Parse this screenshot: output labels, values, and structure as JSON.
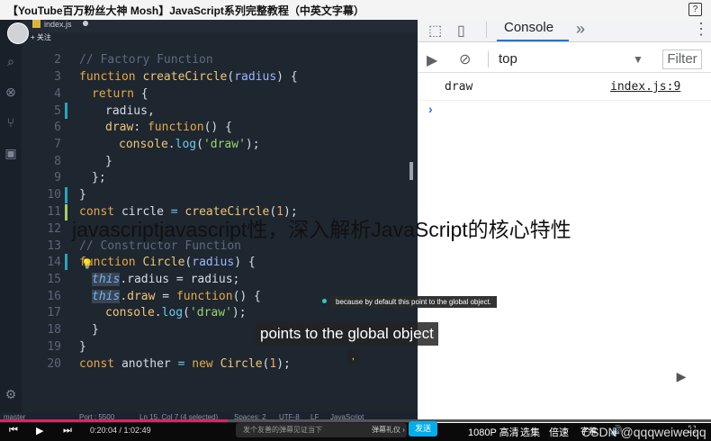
{
  "window": {
    "title": "【YouTube百万粉丝大神 Mosh】JavaScript系列完整教程（中英文字幕）",
    "help_icon": "?"
  },
  "editor": {
    "tab_label": "index.js",
    "follow_label": "+ 关注",
    "lines": [
      {
        "n": "2"
      },
      {
        "n": "3"
      },
      {
        "n": "4"
      },
      {
        "n": "5"
      },
      {
        "n": "6"
      },
      {
        "n": "7"
      },
      {
        "n": "8"
      },
      {
        "n": "9"
      },
      {
        "n": "10"
      },
      {
        "n": "11"
      },
      {
        "n": "12"
      },
      {
        "n": "13"
      },
      {
        "n": "14"
      },
      {
        "n": "15"
      },
      {
        "n": "16"
      },
      {
        "n": "17"
      },
      {
        "n": "18"
      },
      {
        "n": "19"
      },
      {
        "n": "20"
      }
    ],
    "code": {
      "l2": "// Factory Function",
      "l3_kw": "function",
      "l3_fn": "createCircle",
      "l3_param": "radius",
      "l4_kw": "return",
      "l5": "radius,",
      "l6_kw": "draw",
      "l6_fn": "function",
      "l7_obj": "console",
      "l7_m": "log",
      "l7_str": "'draw'",
      "l8": "}",
      "l9": "};",
      "l10": "}",
      "l11_kw": "const",
      "l11_var": "circle",
      "l11_fn": "createCircle",
      "l11_num": "1",
      "l13": "// Constructor Function",
      "l14_kw": "function",
      "l14_fn": "Circle",
      "l14_param": "radius",
      "l15_this": "this",
      "l15_rest": ".radius = radius;",
      "l16_this": "this",
      "l16_prop": ".draw",
      "l16_fn": "function",
      "l17_obj": "console",
      "l17_m": "log",
      "l17_str": "'draw'",
      "l18": "}",
      "l19": "}",
      "l20_kw": "const",
      "l20_var": "another",
      "l20_new": "new",
      "l20_fn": "Circle",
      "l20_num": "1"
    },
    "status": {
      "branch": "master",
      "port": "Port : 5500",
      "position": "Ln 15, Col 7 (4 selected)",
      "spaces": "Spaces: 2",
      "encoding": "UTF-8",
      "eol": "LF",
      "language": "JavaScript"
    }
  },
  "devtools": {
    "tab_console": "Console",
    "more_tabs": "»",
    "menu": "⋮",
    "context": "top",
    "filter_label": "Filter",
    "log_message": "draw",
    "log_source": "index.js:9",
    "prompt": "›"
  },
  "overlays": {
    "article_title": "javascriptjavascript性，深入解析JavaScript的核心特性",
    "hint": "because by default this point to the global object.",
    "subtitle": "points to the global object",
    "subtitle_small": ","
  },
  "player": {
    "current_time": "0:20:04",
    "duration": "1:02:49",
    "danmaku_placeholder": "发个友善的弹幕见证当下",
    "danmaku_etiquette": "弹幕礼仪 ›",
    "send_label": "发送",
    "quality": "1080P 高清",
    "select": "选集",
    "speed": "倍速",
    "subtitle_btn": "字幕",
    "watermark": "CSDN @qqqweiweiqq",
    "progress": 0.32
  }
}
